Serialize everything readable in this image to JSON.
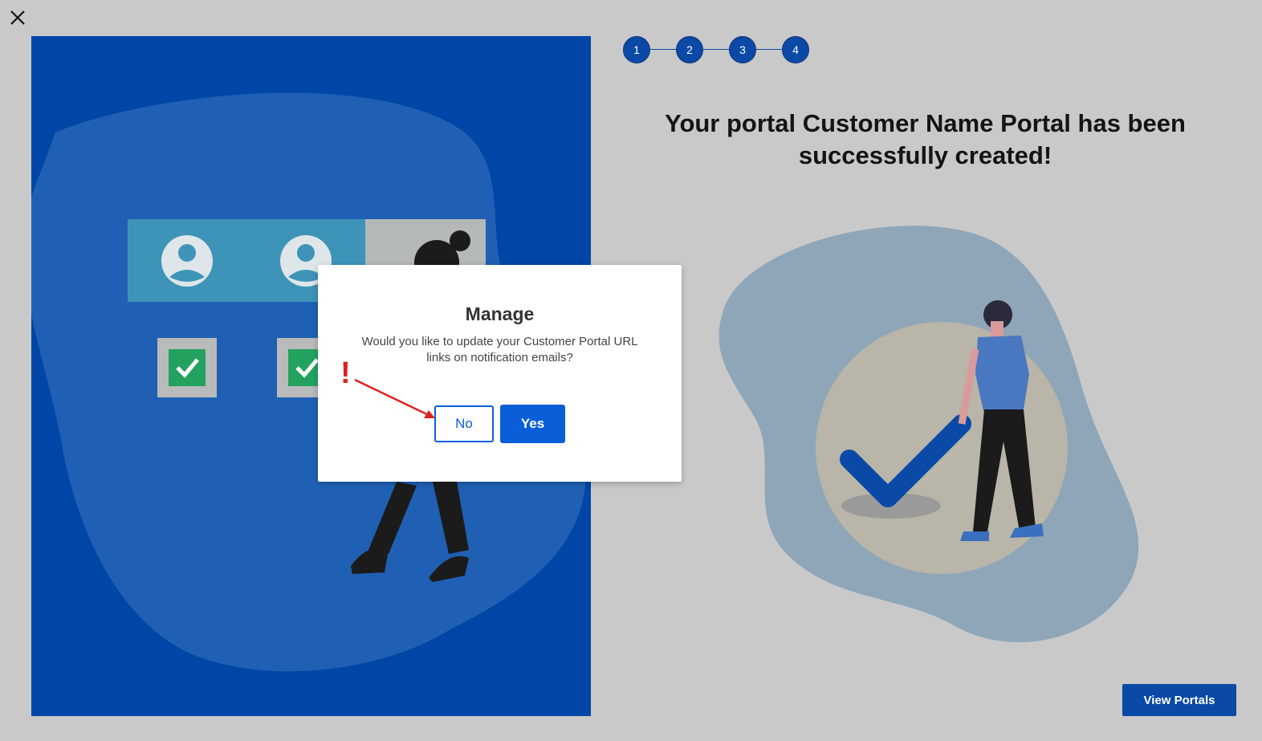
{
  "wizard": {
    "steps": [
      "1",
      "2",
      "3",
      "4"
    ],
    "success_title_line1": "Your portal Customer Name Portal has been",
    "success_title_line2": "successfully created!",
    "view_portals_label": "View Portals"
  },
  "dialog": {
    "title": "Manage",
    "message": "Would you like to update your Customer Portal URL links on notification emails?",
    "no_label": "No",
    "yes_label": "Yes"
  },
  "annotation": {
    "mark": "!"
  },
  "icons": {
    "close": "close-icon",
    "left_illustration": "user-accounts-illustration",
    "right_illustration": "success-checkmark-illustration"
  },
  "colors": {
    "accent": "#0a5fd8",
    "step": "#0a4aa6",
    "left_panel": "#0046a6",
    "overlay_bg": "#c9c9c9"
  }
}
